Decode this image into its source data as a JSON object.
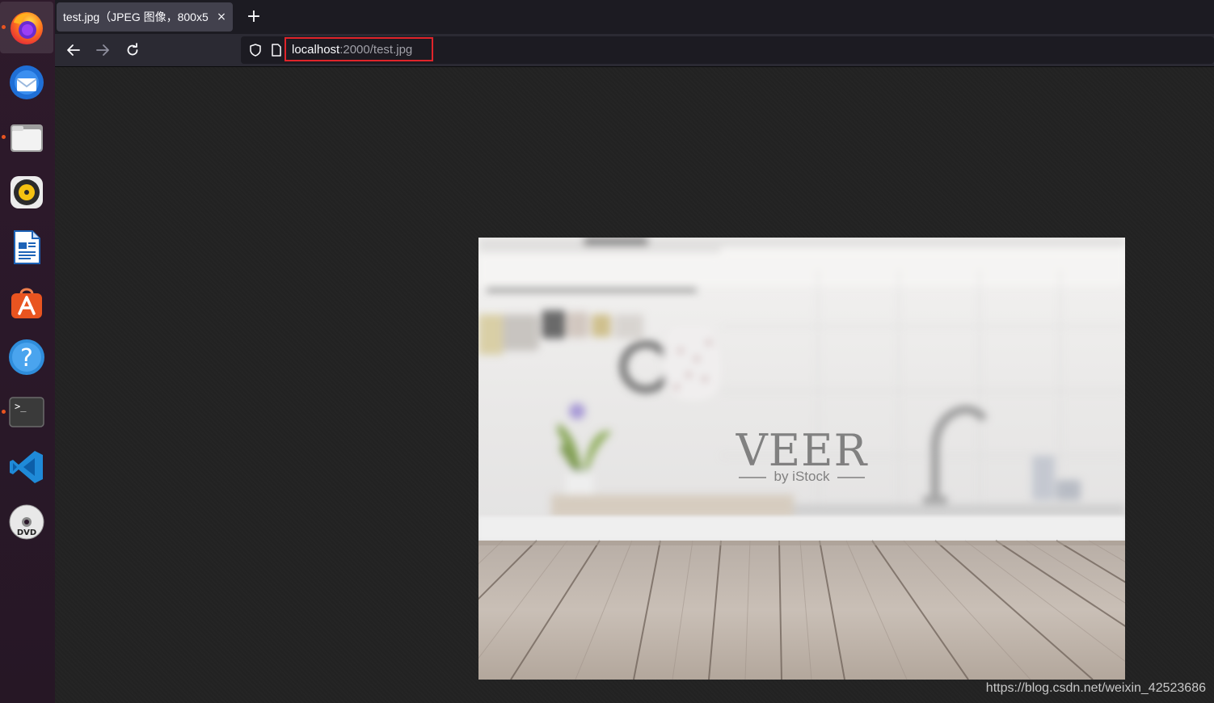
{
  "dock": {
    "items": [
      {
        "name": "firefox",
        "running": true,
        "active": true
      },
      {
        "name": "thunderbird",
        "running": false
      },
      {
        "name": "files",
        "running": true
      },
      {
        "name": "rhythmbox",
        "running": false
      },
      {
        "name": "libreoffice-writer",
        "running": false
      },
      {
        "name": "ubuntu-software",
        "running": false
      },
      {
        "name": "help",
        "running": false
      },
      {
        "name": "terminal",
        "running": true
      },
      {
        "name": "vscode",
        "running": false
      },
      {
        "name": "dvd",
        "running": false
      }
    ]
  },
  "browser": {
    "tab_title": "test.jpg（JPEG 图像，800x5",
    "tab_close": "×",
    "new_tab": "+",
    "url_host": "localhost",
    "url_path": ":2000/test.jpg",
    "url_highlight_color": "#e0242a"
  },
  "image": {
    "watermark_title": "VEER",
    "watermark_sub": "by iStock"
  },
  "footer": {
    "source_url": "https://blog.csdn.net/weixin_42523686"
  },
  "colors": {
    "dock_bg": "#2a1829",
    "accent": "#e95420",
    "tab_bg": "#42414d",
    "content_bg": "#222222"
  }
}
